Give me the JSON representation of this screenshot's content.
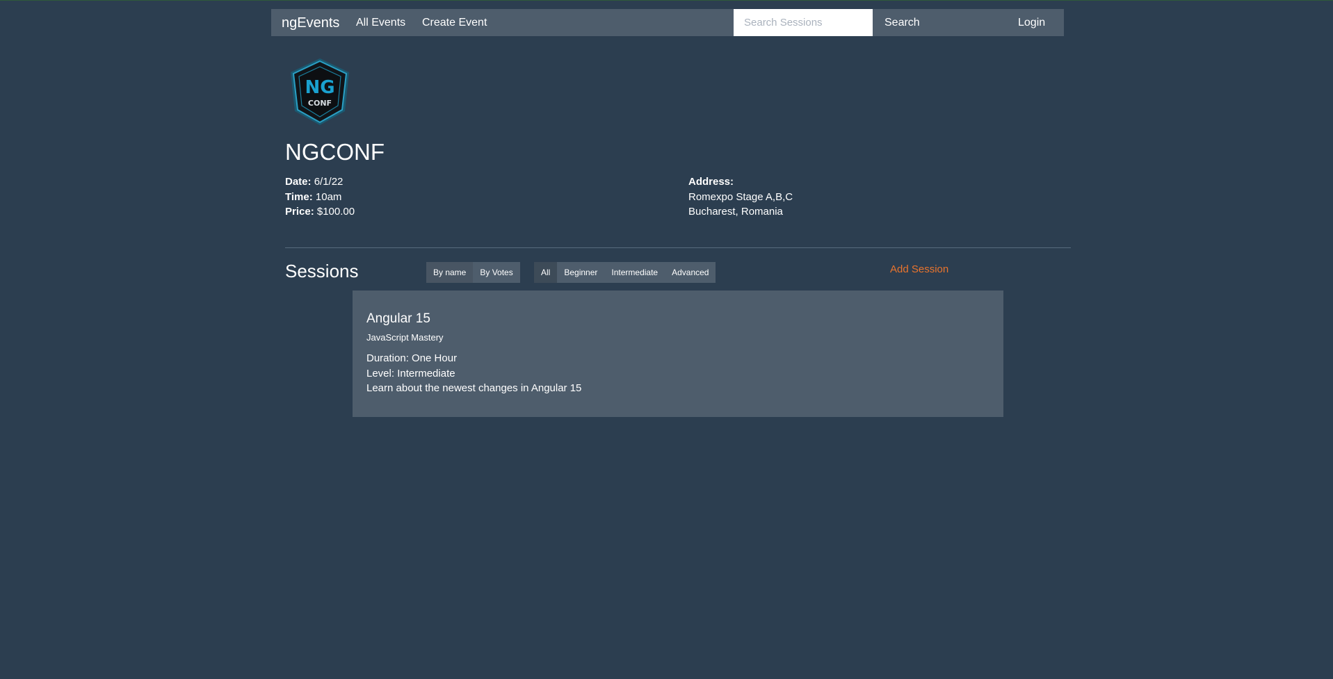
{
  "nav": {
    "brand": "ngEvents",
    "all_events": "All Events",
    "create_event": "Create Event",
    "search_placeholder": "Search Sessions",
    "search_label": "Search",
    "login_label": "Login"
  },
  "event": {
    "logo_icon": "ng-conf-logo",
    "title": "NGCONF",
    "date_label": "Date:",
    "date": "6/1/22",
    "time_label": "Time:",
    "time": "10am",
    "price_label": "Price:",
    "price": "$100.00",
    "address_label": "Address:",
    "address_line1": "Romexpo Stage A,B,C",
    "address_line2": "Bucharest, Romania"
  },
  "sessions": {
    "title": "Sessions",
    "sort_options": [
      "By name",
      "By Votes"
    ],
    "filter_options": [
      "All",
      "Beginner",
      "Intermediate",
      "Advanced"
    ],
    "add_session": "Add Session",
    "items": [
      {
        "name": "Angular 15",
        "presenter": "JavaScript Mastery",
        "duration": "Duration: One Hour",
        "level": "Level: Intermediate",
        "abstract": "Learn about the newest changes in Angular 15"
      }
    ]
  },
  "colors": {
    "background": "#2c3e50",
    "navbar": "#4e5d6c",
    "accent": "#e9742d"
  }
}
